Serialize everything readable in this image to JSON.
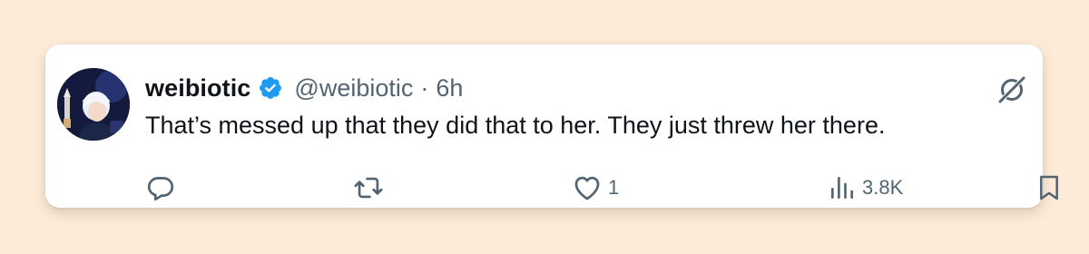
{
  "tweet": {
    "display_name": "weibiotic",
    "handle": "@weibiotic",
    "separator": "·",
    "time": "6h",
    "text": "That’s messed up that they did that to her. They just threw her there.",
    "verified": true
  },
  "actions": {
    "reply_count": "",
    "retweet_count": "",
    "like_count": "1",
    "views_count": "3.8K"
  },
  "icons": {
    "verified": "verified-badge-icon",
    "grok": "grok-icon",
    "reply": "reply-icon",
    "retweet": "retweet-icon",
    "like": "heart-icon",
    "views": "views-icon",
    "bookmark": "bookmark-icon"
  },
  "colors": {
    "background": "#fcebd8",
    "card": "#ffffff",
    "text_primary": "#0f1419",
    "text_secondary": "#536471",
    "verified_blue": "#1d9bf0"
  }
}
